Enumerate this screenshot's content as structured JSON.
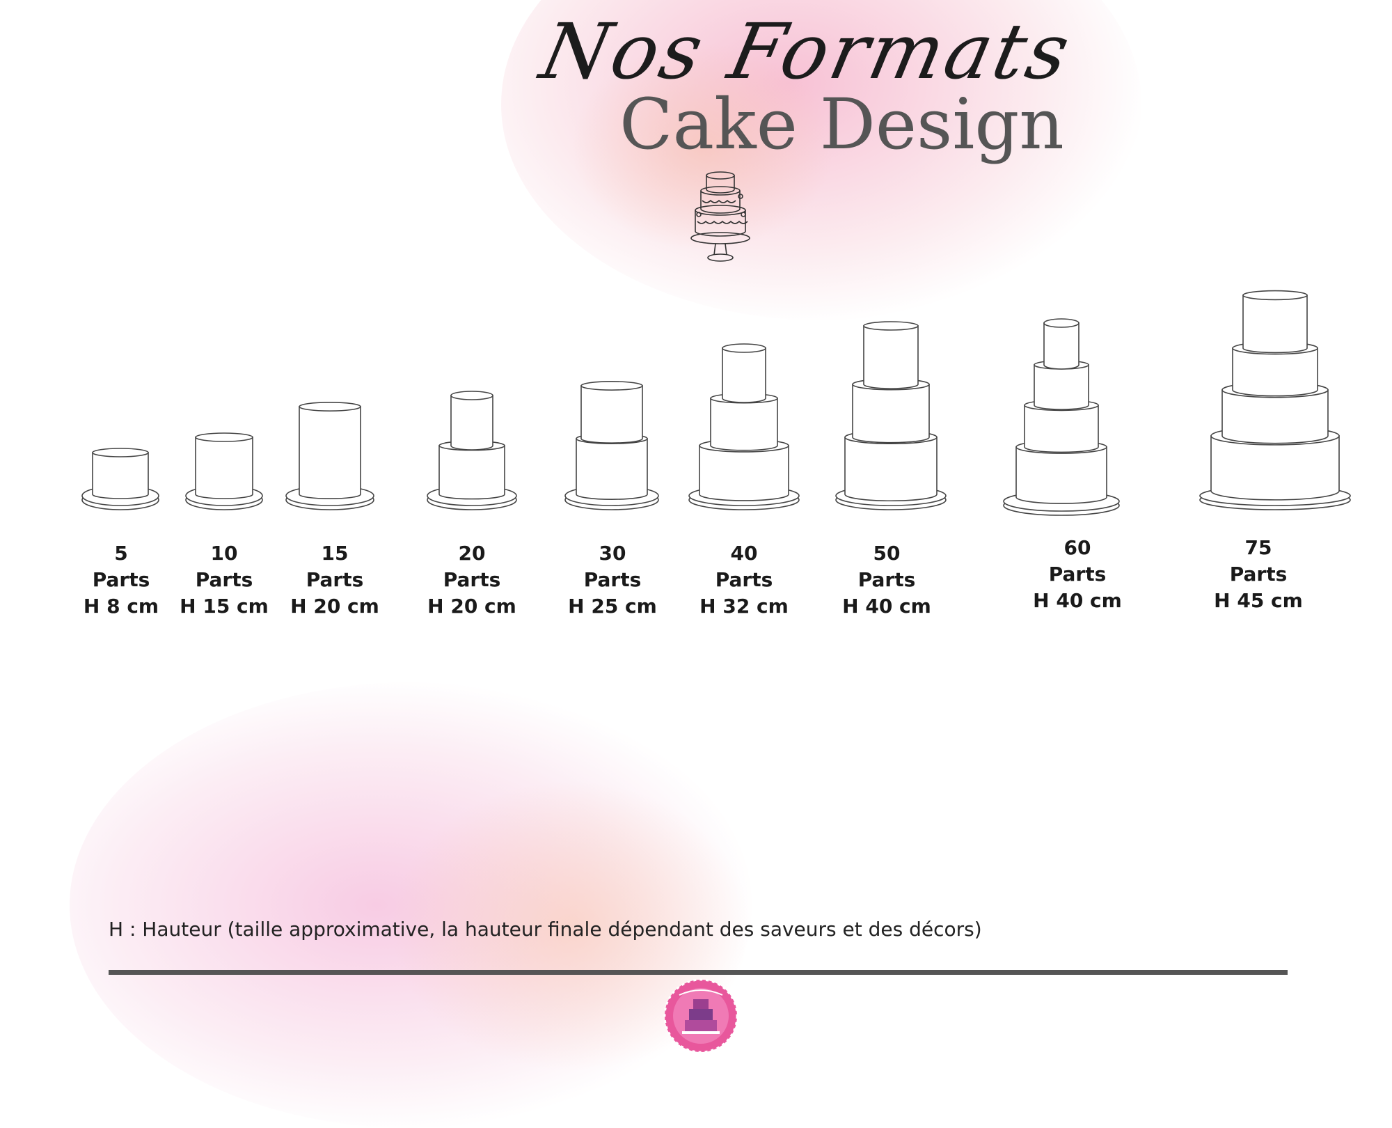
{
  "header": {
    "script_title": "Nos Formats",
    "main_title": "Cake Design"
  },
  "formats": [
    {
      "parts": "5",
      "unit": "Parts",
      "height": "H 8 cm"
    },
    {
      "parts": "10",
      "unit": "Parts",
      "height": "H 15 cm"
    },
    {
      "parts": "15",
      "unit": "Parts",
      "height": "H 20 cm"
    },
    {
      "parts": "20",
      "unit": "Parts",
      "height": "H 20 cm"
    },
    {
      "parts": "30",
      "unit": "Parts",
      "height": "H 25 cm"
    },
    {
      "parts": "40",
      "unit": "Parts",
      "height": "H 32 cm"
    },
    {
      "parts": "50",
      "unit": "Parts",
      "height": "H 40 cm"
    },
    {
      "parts": "60",
      "unit": "Parts",
      "height": "H 40 cm"
    },
    {
      "parts": "75",
      "unit": "Parts",
      "height": "H 45 cm"
    }
  ],
  "footnote": "H : Hauteur (taille approximative, la hauteur finale dépendant des saveurs et des décors)",
  "colors": {
    "watercolor_pink": "#f3b6d3",
    "watercolor_peach": "#f6c7bd",
    "divider": "#555555",
    "logo_pink": "#e8579c"
  },
  "icons": {
    "header": "tiered-cake-icon",
    "footer": "bakery-logo-icon"
  }
}
